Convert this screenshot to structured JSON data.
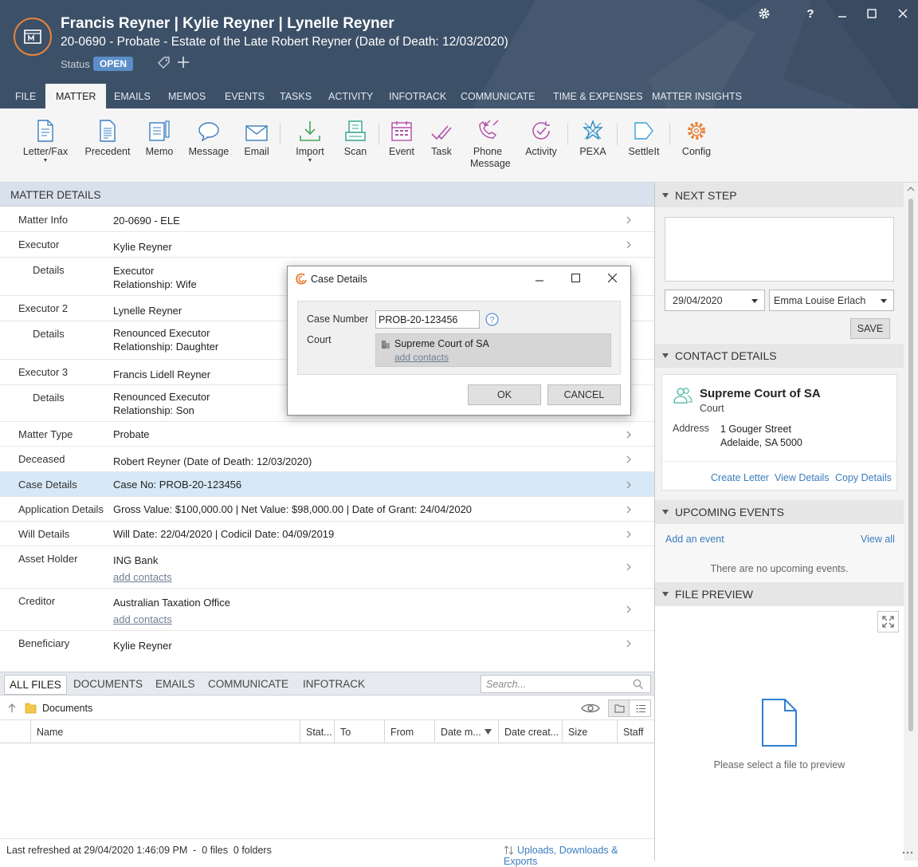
{
  "header": {
    "title": "Francis Reyner | Kylie Reyner | Lynelle Reyner",
    "subtitle": "20-0690 - Probate - Estate of the Late Robert Reyner (Date of Death: 12/03/2020)",
    "status_label": "Status",
    "status_value": "OPEN"
  },
  "tabs": [
    "FILE",
    "MATTER",
    "EMAILS",
    "MEMOS",
    "EVENTS",
    "TASKS",
    "ACTIVITY",
    "INFOTRACK",
    "COMMUNICATE",
    "TIME & EXPENSES",
    "MATTER INSIGHTS"
  ],
  "ribbon": {
    "letter": "Letter/Fax",
    "precedent": "Precedent",
    "memo": "Memo",
    "message": "Message",
    "email": "Email",
    "import": "Import",
    "scan": "Scan",
    "event": "Event",
    "task": "Task",
    "phone1": "Phone",
    "phone2": "Message",
    "activity": "Activity",
    "pexa": "PEXA",
    "settleit": "SettleIt",
    "config": "Config"
  },
  "matter": {
    "heading": "MATTER DETAILS",
    "info_k": "Matter Info",
    "info_v": "20-0690 - ELE",
    "ex1_k": "Executor",
    "ex1_v": "Kylie Reyner",
    "det_k": "Details",
    "ex1_d1": "Executor",
    "ex1_d2": "Relationship: Wife",
    "ex2_k": "Executor 2",
    "ex2_v": "Lynelle Reyner",
    "ex2_d1": "Renounced Executor",
    "ex2_d2": "Relationship: Daughter",
    "ex3_k": "Executor 3",
    "ex3_v": "Francis Lidell Reyner",
    "ex3_d1": "Renounced Executor",
    "ex3_d2": "Relationship: Son",
    "type_k": "Matter Type",
    "type_v": "Probate",
    "dec_k": "Deceased",
    "dec_v": "Robert Reyner (Date of Death: 12/03/2020)",
    "case_k": "Case Details",
    "case_v": "Case No: PROB-20-123456",
    "app_k": "Application Details",
    "app_v": "Gross Value: $100,000.00 | Net Value: $98,000.00 | Date of Grant: 24/04/2020",
    "will_k": "Will Details",
    "will_v": "Will Date: 22/04/2020 | Codicil Date: 04/09/2019",
    "asset_k": "Asset Holder",
    "asset_v": "ING Bank",
    "cred_k": "Creditor",
    "cred_v": "Australian Taxation Office",
    "add_contacts": "add contacts",
    "ben_k": "Beneficiary",
    "ben_v": "Kylie Reyner"
  },
  "files": {
    "tabs": [
      "ALL FILES",
      "DOCUMENTS",
      "EMAILS",
      "COMMUNICATE",
      "INFOTRACK"
    ],
    "search_placeholder": "Search...",
    "folder": "Documents",
    "cols": [
      "Name",
      "Stat...",
      "To",
      "From",
      "Date m...",
      "Date creat...",
      "Size",
      "Staff"
    ],
    "status": "Last refreshed at 29/04/2020 1:46:09 PM  -  0 files  0 folders",
    "uploads": "Uploads, Downloads & Exports"
  },
  "right": {
    "next_step": "NEXT STEP",
    "date": "29/04/2020",
    "staff": "Emma Louise Erlach",
    "save": "SAVE",
    "contact_details": "CONTACT DETAILS",
    "contact_name": "Supreme Court of SA",
    "contact_role": "Court",
    "address_label": "Address",
    "address1": "1 Gouger Street",
    "address2": "Adelaide, SA 5000",
    "create_letter": "Create Letter",
    "view_details": "View Details",
    "copy_details": "Copy Details",
    "upcoming": "UPCOMING EVENTS",
    "add_event": "Add an event",
    "view_all": "View all",
    "no_events": "There are no upcoming events.",
    "file_preview": "FILE PREVIEW",
    "preview_hint": "Please select a file to preview"
  },
  "dialog": {
    "title": "Case Details",
    "case_label": "Case Number",
    "case_value": "PROB-20-123456",
    "court_label": "Court",
    "court_value": "Supreme Court of SA",
    "add_contacts": "add contacts",
    "ok": "OK",
    "cancel": "CANCEL"
  }
}
